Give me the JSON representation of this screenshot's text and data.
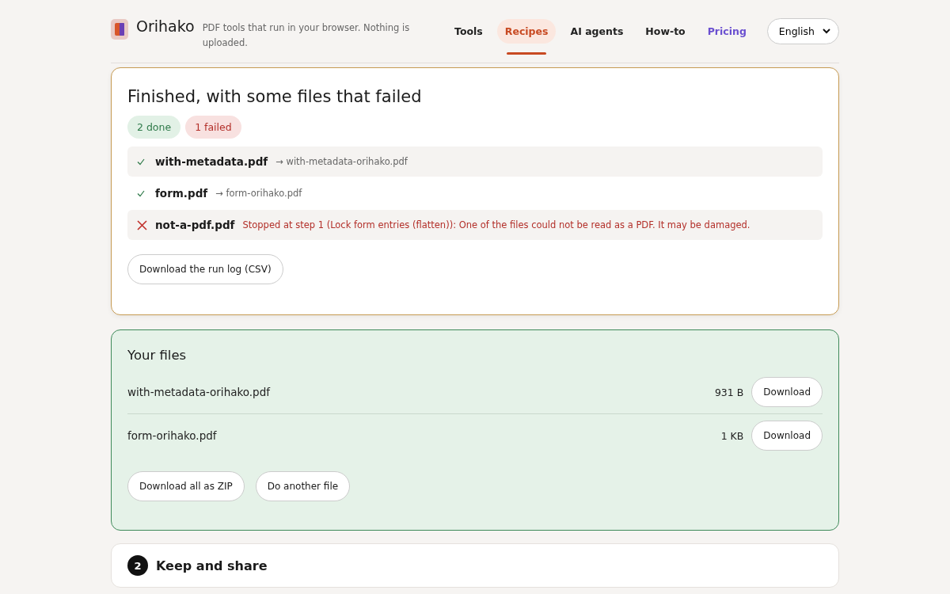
{
  "header": {
    "brand": "Orihako",
    "tagline": "PDF tools that run in your browser. Nothing is uploaded.",
    "nav": [
      {
        "label": "Tools",
        "selected": false,
        "kind": "plain"
      },
      {
        "label": "Recipes",
        "selected": true,
        "kind": "plain"
      },
      {
        "label": "AI agents",
        "selected": false,
        "kind": "plain"
      },
      {
        "label": "How-to",
        "selected": false,
        "kind": "plain"
      },
      {
        "label": "Pricing",
        "selected": false,
        "kind": "accent"
      }
    ],
    "language": "English"
  },
  "result": {
    "title": "Finished, with some files that failed",
    "badges": [
      {
        "label": "2 done",
        "kind": "ok"
      },
      {
        "label": "1 failed",
        "kind": "fail"
      }
    ],
    "files": [
      {
        "kind": "ok",
        "name": "with-metadata.pdf",
        "detail": "→ with-metadata-orihako.pdf"
      },
      {
        "kind": "ok",
        "name": "form.pdf",
        "detail": "→ form-orihako.pdf"
      },
      {
        "kind": "fail",
        "name": "not-a-pdf.pdf",
        "detail": "Stopped at step 1 (Lock form entries (flatten)): One of the files could not be read as a PDF. It may be damaged."
      }
    ],
    "log_button": "Download the run log (CSV)"
  },
  "your_files": {
    "title": "Your files",
    "files": [
      {
        "name": "with-metadata-orihako.pdf",
        "size": "931 B",
        "button": "Download"
      },
      {
        "name": "form-orihako.pdf",
        "size": "1 KB",
        "button": "Download"
      }
    ],
    "actions": [
      "Download all as ZIP",
      "Do another file"
    ]
  },
  "next_step": {
    "number": "2",
    "title": "Keep and share"
  }
}
